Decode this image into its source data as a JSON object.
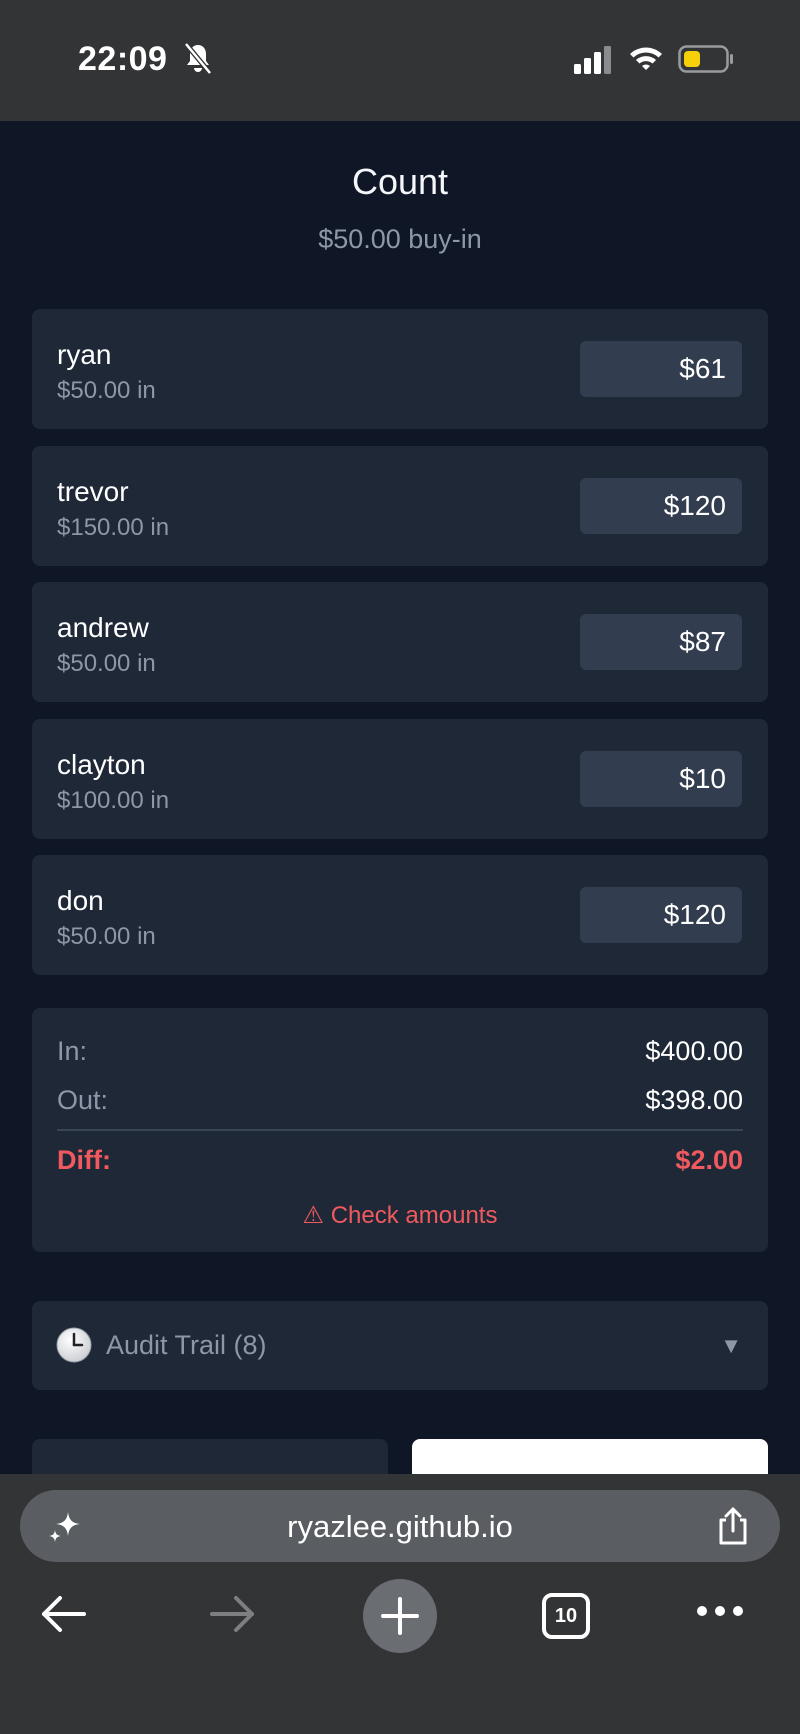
{
  "status_bar": {
    "time": "22:09"
  },
  "header": {
    "title": "Count",
    "subtitle": "$50.00 buy-in"
  },
  "players": [
    {
      "name": "ryan",
      "in": "$50.00 in",
      "amount": "$61"
    },
    {
      "name": "trevor",
      "in": "$150.00 in",
      "amount": "$120"
    },
    {
      "name": "andrew",
      "in": "$50.00 in",
      "amount": "$87"
    },
    {
      "name": "clayton",
      "in": "$100.00 in",
      "amount": "$10"
    },
    {
      "name": "don",
      "in": "$50.00 in",
      "amount": "$120"
    }
  ],
  "summary": {
    "in_label": "In:",
    "in_value": "$400.00",
    "out_label": "Out:",
    "out_value": "$398.00",
    "diff_label": "Diff:",
    "diff_value": "$2.00",
    "warning": "⚠ Check amounts"
  },
  "audit": {
    "label": "Audit Trail (8)",
    "icon": "clock-icon"
  },
  "browser": {
    "url": "ryazlee.github.io",
    "tab_count": "10"
  },
  "colors": {
    "background": "#0f1726",
    "card": "#1e2837",
    "input": "#323d50",
    "muted": "#8d97a8",
    "error": "#f05a5f",
    "chrome": "#333436"
  }
}
